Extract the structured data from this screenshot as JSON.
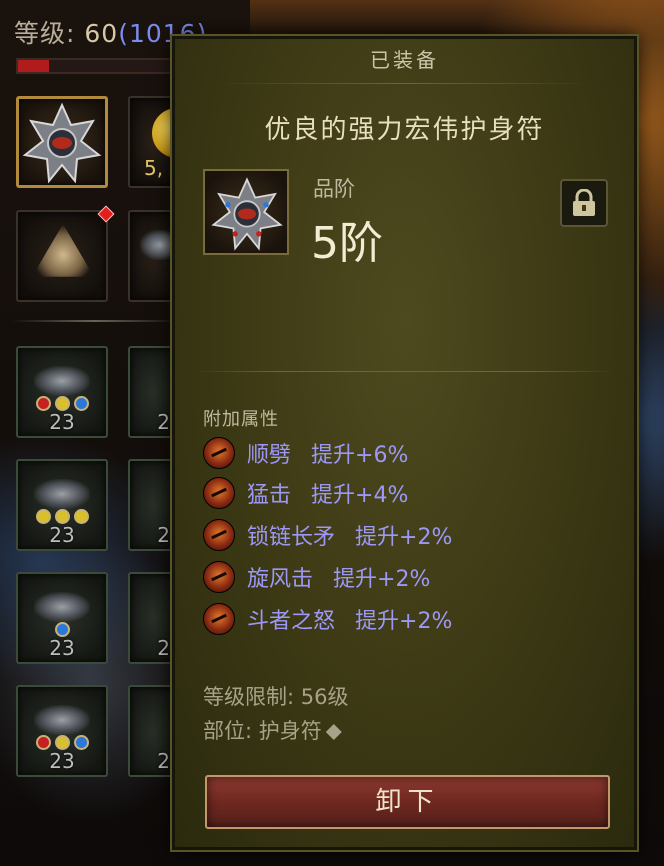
{
  "hud": {
    "level_prefix": "等级: ",
    "level": "60",
    "paragon": "(1016)",
    "xp_progress": 0.2
  },
  "inventory": {
    "coin_count": "5,",
    "slots": [
      {
        "level": "23",
        "gems": [
          "r",
          "y",
          "b"
        ]
      },
      {
        "level": "23",
        "gems": [
          "y",
          "y",
          "y"
        ]
      },
      {
        "level": "23",
        "gems": [
          "b"
        ]
      },
      {
        "level": "23",
        "gems": [
          "r",
          "y",
          "b"
        ]
      }
    ],
    "partial_slot_levels": [
      "2",
      "2",
      "2",
      "2"
    ]
  },
  "tooltip": {
    "header": "已装备",
    "item_name": "优良的强力宏伟护身符",
    "grade_label": "品阶",
    "grade_value": "5阶",
    "attributes_heading": "附加属性",
    "attributes": [
      {
        "icon": "sweep-skill-icon",
        "name": "顺劈",
        "bonus": "提升+6%"
      },
      {
        "icon": "frenzy-skill-icon",
        "name": "猛击",
        "bonus": "提升+4%"
      },
      {
        "icon": "chain-spear-skill-icon",
        "name": "锁链长矛",
        "bonus": "提升+2%"
      },
      {
        "icon": "whirlwind-skill-icon",
        "name": "旋风击",
        "bonus": "提升+2%"
      },
      {
        "icon": "fighter-rage-skill-icon",
        "name": "斗者之怒",
        "bonus": "提升+2%"
      }
    ],
    "level_requirement": "等级限制: 56级",
    "slot_label": "部位: 护身符",
    "unequip_label": "卸下"
  },
  "colors": {
    "panel_bg": "#3b3814",
    "attribute_text": "#9d98f6",
    "button_red": "#6e2820"
  }
}
